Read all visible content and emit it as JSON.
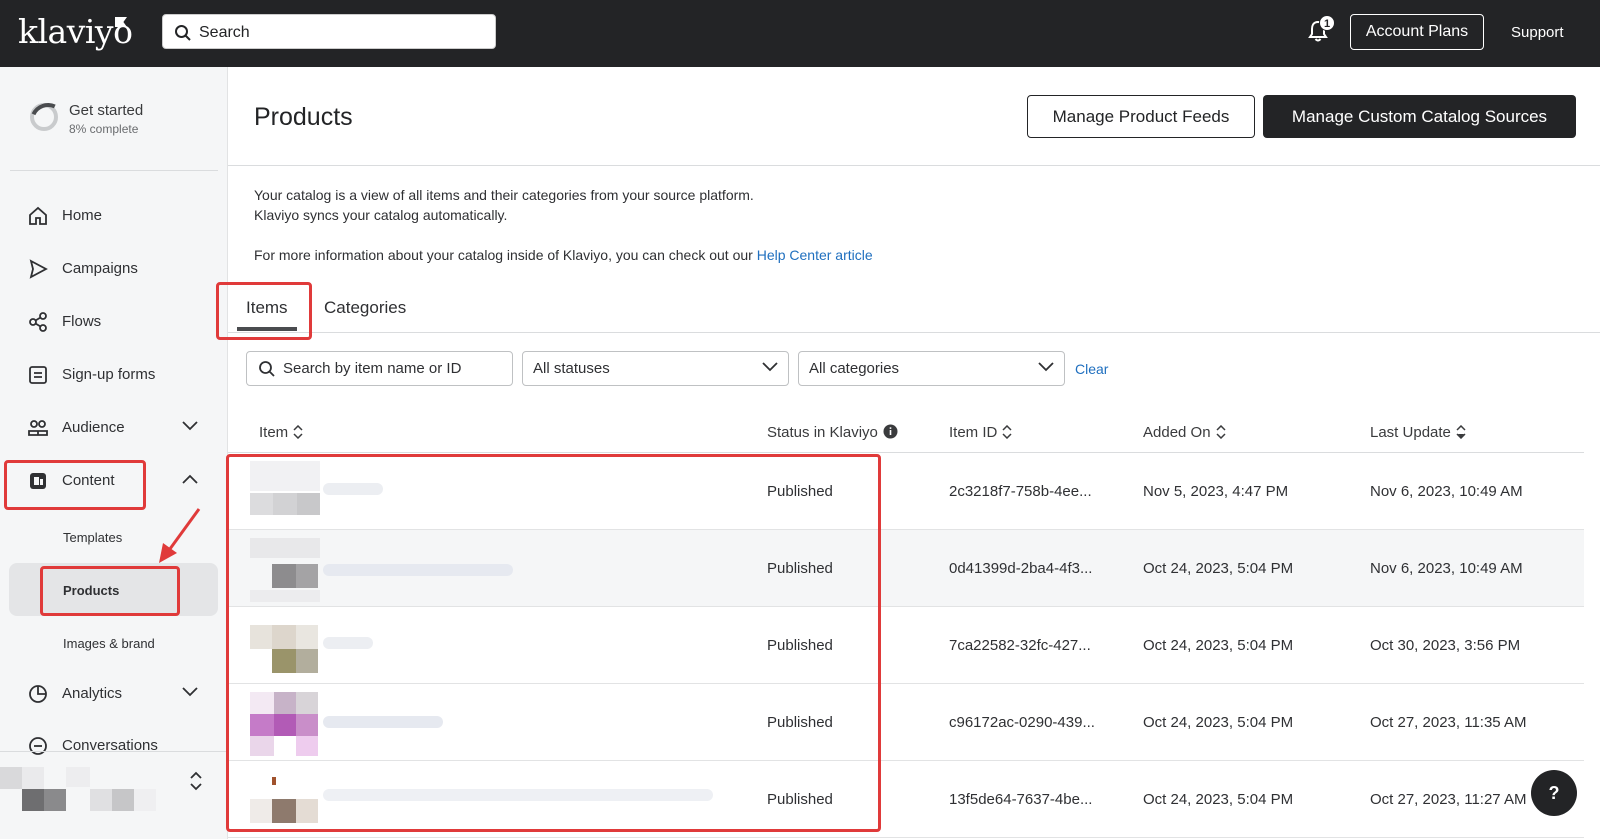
{
  "topbar": {
    "logo": "klaviyo",
    "search_placeholder": "Search",
    "notification_count": "1",
    "account_plans": "Account Plans",
    "support": "Support"
  },
  "sidebar": {
    "get_started": {
      "title": "Get started",
      "progress": "8% complete"
    },
    "items": [
      {
        "label": "Home",
        "icon": "home-icon"
      },
      {
        "label": "Campaigns",
        "icon": "send-icon"
      },
      {
        "label": "Flows",
        "icon": "flows-icon"
      },
      {
        "label": "Sign-up forms",
        "icon": "form-icon"
      },
      {
        "label": "Audience",
        "icon": "audience-icon"
      },
      {
        "label": "Content",
        "icon": "content-icon"
      },
      {
        "label": "Analytics",
        "icon": "analytics-icon"
      },
      {
        "label": "Conversations",
        "icon": "conversations-icon"
      }
    ],
    "content_sub": [
      "Templates",
      "Products",
      "Images & brand"
    ]
  },
  "main": {
    "title": "Products",
    "manage_feeds": "Manage Product Feeds",
    "manage_custom": "Manage Custom Catalog Sources",
    "desc_line1": "Your catalog is a view of all items and their categories from your source platform.",
    "desc_line2": "Klaviyo syncs your catalog automatically.",
    "desc_line3": "For more information about your catalog inside of Klaviyo, you can check out our",
    "help_link": "Help Center article",
    "tabs": [
      "Items",
      "Categories"
    ],
    "filters": {
      "search_placeholder": "Search by item name or ID",
      "status": "All statuses",
      "category": "All categories",
      "clear": "Clear"
    },
    "columns": [
      "Item",
      "Status in Klaviyo",
      "Item ID",
      "Added On",
      "Last Update"
    ],
    "rows": [
      {
        "status": "Published",
        "id": "2c3218f7-758b-4ee...",
        "added": "Nov 5, 2023, 4:47 PM",
        "updated": "Nov 6, 2023, 10:49 AM"
      },
      {
        "status": "Published",
        "id": "0d41399d-2ba4-4f3...",
        "added": "Oct 24, 2023, 5:04 PM",
        "updated": "Nov 6, 2023, 10:49 AM"
      },
      {
        "status": "Published",
        "id": "7ca22582-32fc-427...",
        "added": "Oct 24, 2023, 5:04 PM",
        "updated": "Oct 30, 2023, 3:56 PM"
      },
      {
        "status": "Published",
        "id": "c96172ac-0290-439...",
        "added": "Oct 24, 2023, 5:04 PM",
        "updated": "Oct 27, 2023, 11:35 AM"
      },
      {
        "status": "Published",
        "id": "13f5de64-7637-4be...",
        "added": "Oct 24, 2023, 5:04 PM",
        "updated": "Oct 27, 2023, 11:27 AM"
      }
    ],
    "help_button": "?"
  },
  "colors": {
    "dark": "#232426",
    "link": "#1f6fbf",
    "highlight": "#e03a3a",
    "sidebar_bg": "#f5f6f7"
  }
}
